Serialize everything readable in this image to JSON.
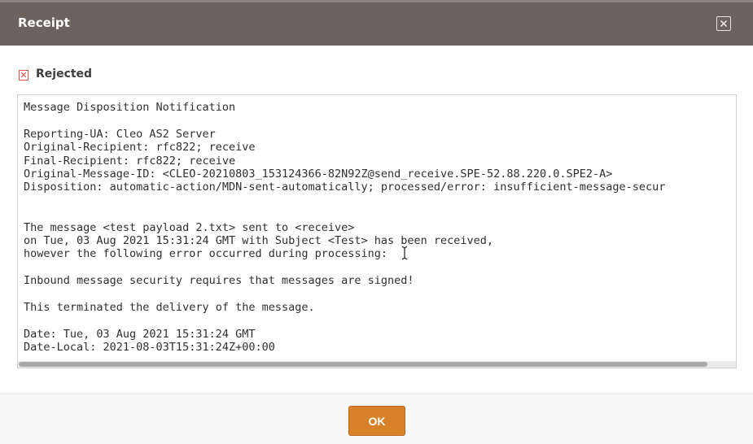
{
  "dialog": {
    "title": "Receipt",
    "close_icon": "close-icon"
  },
  "status": {
    "icon": "rejected-x-icon",
    "label": "Rejected",
    "color": "#d9534f"
  },
  "message": {
    "lines": [
      "Message Disposition Notification",
      "",
      "Reporting-UA: Cleo AS2 Server",
      "Original-Recipient: rfc822; receive",
      "Final-Recipient: rfc822; receive",
      "Original-Message-ID: <CLEO-20210803_153124366-82N92Z@send_receive.SPE-52.88.220.0.SPE2-A>",
      "Disposition: automatic-action/MDN-sent-automatically; processed/error: insufficient-message-secur",
      "",
      "",
      "The message <test payload 2.txt> sent to <receive>",
      "on Tue, 03 Aug 2021 15:31:24 GMT with Subject <Test> has been received,",
      "however the following error occurred during processing:",
      "",
      "Inbound message security requires that messages are signed!",
      "",
      "This terminated the delivery of the message.",
      "",
      "Date: Tue, 03 Aug 2021 15:31:24 GMT",
      "Date-Local: 2021-08-03T15:31:24Z+00:00"
    ]
  },
  "footer": {
    "ok_label": "OK"
  },
  "colors": {
    "titlebar": "#6b635d",
    "accent": "#d8812b"
  }
}
